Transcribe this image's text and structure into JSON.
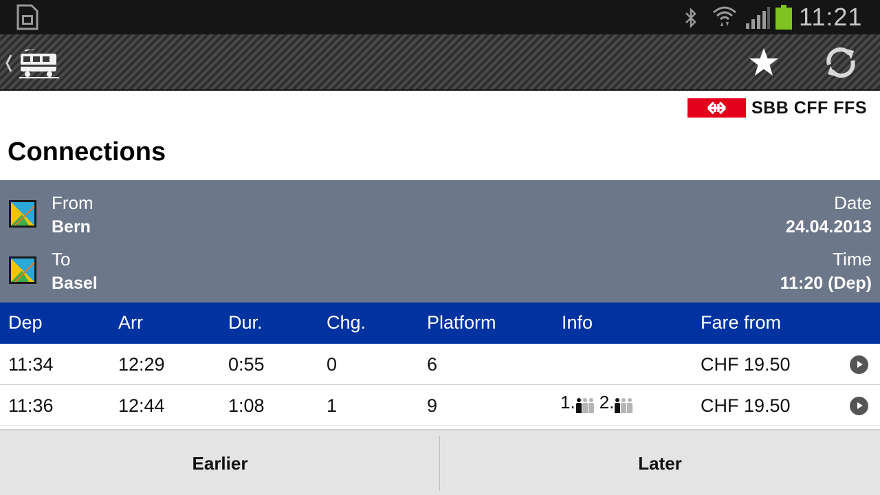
{
  "status_bar": {
    "time": "11:21",
    "icons": [
      "sim-card-icon",
      "bluetooth-icon",
      "wifi-icon",
      "signal-icon",
      "battery-icon"
    ],
    "battery_color": "#7ec31f"
  },
  "action_bar": {
    "back_icon": "train-back-icon",
    "actions": [
      "star-icon",
      "refresh-icon"
    ]
  },
  "logo": {
    "text": "SBB CFF FFS",
    "flag_color": "#e2001a"
  },
  "page_title": "Connections",
  "summary": {
    "from_label": "From",
    "from_value": "Bern",
    "to_label": "To",
    "to_value": "Basel",
    "date_label": "Date",
    "date_value": "24.04.2013",
    "time_label": "Time",
    "time_value": "11:20 (Dep)",
    "panel_color": "#6c7889"
  },
  "table": {
    "header_color": "#0033a0",
    "columns": [
      "Dep",
      "Arr",
      "Dur.",
      "Chg.",
      "Platform",
      "Info",
      "Fare from"
    ],
    "rows": [
      {
        "dep": "11:34",
        "arr": "12:29",
        "dur": "0:55",
        "chg": "0",
        "platform": "6",
        "info": "",
        "fare": "CHF 19.50"
      },
      {
        "dep": "11:36",
        "arr": "12:44",
        "dur": "1:08",
        "chg": "1",
        "platform": "9",
        "info": "occupancy",
        "occupancy": {
          "first_class_label": "1.",
          "first_class_level": 1,
          "second_class_label": "2.",
          "second_class_level": 1,
          "max_level": 3
        },
        "fare": "CHF 19.50"
      }
    ]
  },
  "bottom_bar": {
    "earlier_label": "Earlier",
    "later_label": "Later"
  }
}
